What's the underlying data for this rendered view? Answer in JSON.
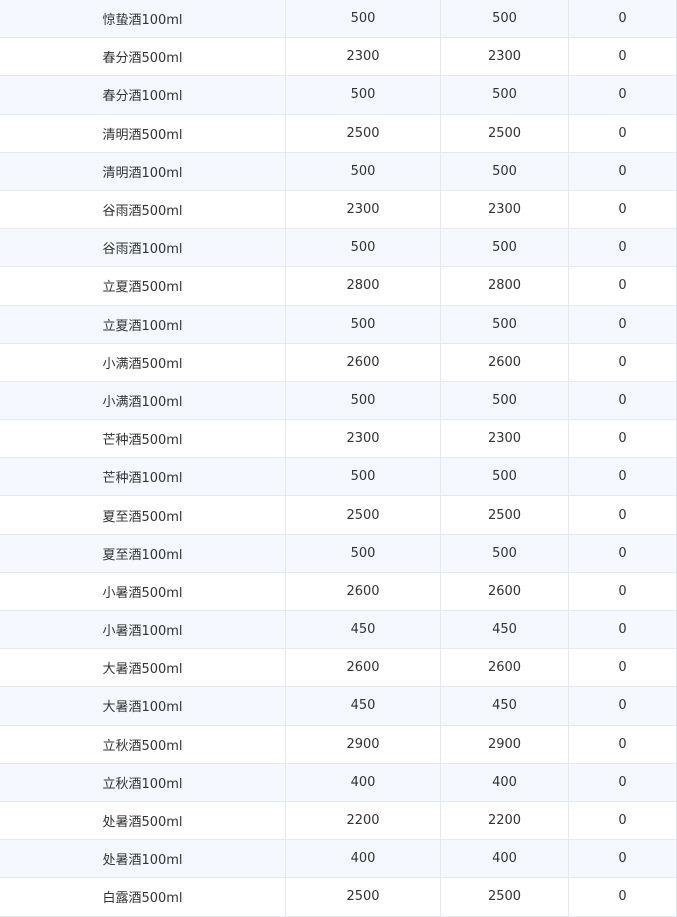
{
  "table": {
    "rows": [
      {
        "name": "惊蛰酒100ml",
        "v1": "500",
        "v2": "500",
        "v3": "0"
      },
      {
        "name": "春分酒500ml",
        "v1": "2300",
        "v2": "2300",
        "v3": "0"
      },
      {
        "name": "春分酒100ml",
        "v1": "500",
        "v2": "500",
        "v3": "0"
      },
      {
        "name": "清明酒500ml",
        "v1": "2500",
        "v2": "2500",
        "v3": "0"
      },
      {
        "name": "清明酒100ml",
        "v1": "500",
        "v2": "500",
        "v3": "0"
      },
      {
        "name": "谷雨酒500ml",
        "v1": "2300",
        "v2": "2300",
        "v3": "0"
      },
      {
        "name": "谷雨酒100ml",
        "v1": "500",
        "v2": "500",
        "v3": "0"
      },
      {
        "name": "立夏酒500ml",
        "v1": "2800",
        "v2": "2800",
        "v3": "0"
      },
      {
        "name": "立夏酒100ml",
        "v1": "500",
        "v2": "500",
        "v3": "0"
      },
      {
        "name": "小满酒500ml",
        "v1": "2600",
        "v2": "2600",
        "v3": "0"
      },
      {
        "name": "小满酒100ml",
        "v1": "500",
        "v2": "500",
        "v3": "0"
      },
      {
        "name": "芒种酒500ml",
        "v1": "2300",
        "v2": "2300",
        "v3": "0"
      },
      {
        "name": "芒种酒100ml",
        "v1": "500",
        "v2": "500",
        "v3": "0"
      },
      {
        "name": "夏至酒500ml",
        "v1": "2500",
        "v2": "2500",
        "v3": "0"
      },
      {
        "name": "夏至酒100ml",
        "v1": "500",
        "v2": "500",
        "v3": "0"
      },
      {
        "name": "小暑酒500ml",
        "v1": "2600",
        "v2": "2600",
        "v3": "0"
      },
      {
        "name": "小暑酒100ml",
        "v1": "450",
        "v2": "450",
        "v3": "0"
      },
      {
        "name": "大暑酒500ml",
        "v1": "2600",
        "v2": "2600",
        "v3": "0"
      },
      {
        "name": "大暑酒100ml",
        "v1": "450",
        "v2": "450",
        "v3": "0"
      },
      {
        "name": "立秋酒500ml",
        "v1": "2900",
        "v2": "2900",
        "v3": "0"
      },
      {
        "name": "立秋酒100ml",
        "v1": "400",
        "v2": "400",
        "v3": "0"
      },
      {
        "name": "处暑酒500ml",
        "v1": "2200",
        "v2": "2200",
        "v3": "0"
      },
      {
        "name": "处暑酒100ml",
        "v1": "400",
        "v2": "400",
        "v3": "0"
      },
      {
        "name": "白露酒500ml",
        "v1": "2500",
        "v2": "2500",
        "v3": "0"
      }
    ]
  },
  "colors": {
    "row_stripe": "#f5f9ff",
    "row_plain": "#ffffff",
    "grid_line": "#e6eaf0",
    "text": "#333333"
  }
}
